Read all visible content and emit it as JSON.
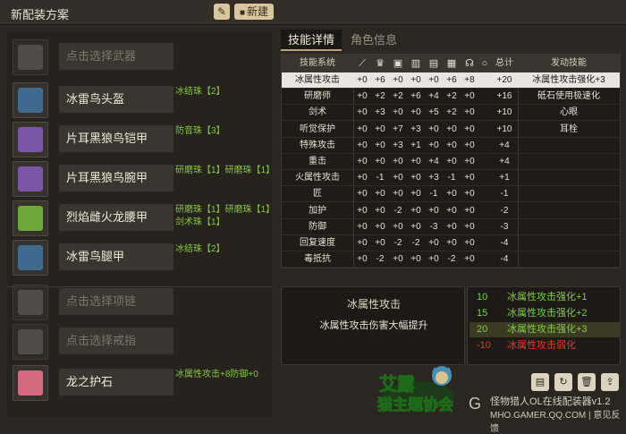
{
  "titlebar": {
    "title": "新配装方案",
    "new_label": "新建",
    "edit_icon": "pencil-icon"
  },
  "slots": [
    {
      "name": "点击选择武器",
      "deco": "",
      "empty": true,
      "icon": "weapon-icon",
      "color": "#6d6a63"
    },
    {
      "name": "冰雷鸟头盔",
      "deco": "冰结珠【2】",
      "empty": false,
      "icon": "helmet-icon",
      "color": "#3e6a8f"
    },
    {
      "name": "片耳黑狼鸟铠甲",
      "deco": "防音珠【3】",
      "empty": false,
      "icon": "chest-icon",
      "color": "#7b55a6"
    },
    {
      "name": "片耳黑狼鸟腕甲",
      "deco": "研磨珠【1】研磨珠【1】",
      "empty": false,
      "icon": "arm-icon",
      "color": "#7b55a6"
    },
    {
      "name": "烈焰雌火龙腰甲",
      "deco": "研磨珠【1】研磨珠【1】剑术珠【1】",
      "empty": false,
      "icon": "waist-icon",
      "color": "#6da63a"
    },
    {
      "name": "冰雷鸟腿甲",
      "deco": "冰结珠【2】",
      "empty": false,
      "icon": "legs-icon",
      "color": "#3e6a8f"
    },
    {
      "name": "点击选择项链",
      "deco": "",
      "empty": true,
      "icon": "necklace-icon",
      "color": "#6d6a63"
    },
    {
      "name": "点击选择戒指",
      "deco": "",
      "empty": true,
      "icon": "ring-icon",
      "color": "#6d6a63"
    },
    {
      "name": "龙之护石",
      "deco": "冰属性攻击+8防御+0",
      "empty": false,
      "icon": "charm-icon",
      "color": "#d46a7e"
    }
  ],
  "tabs": {
    "skills": "技能详情",
    "stats": "角色信息"
  },
  "table": {
    "headers": {
      "system": "技能系统",
      "total": "总计",
      "activated": "发动技能"
    },
    "rows": [
      {
        "name": "冰属性攻击",
        "vals": [
          "+0",
          "+6",
          "+0",
          "+0",
          "+0",
          "+6",
          "+8"
        ],
        "total": "+20",
        "act": "冰属性攻击强化+3",
        "selected": true
      },
      {
        "name": "研磨师",
        "vals": [
          "+0",
          "+2",
          "+2",
          "+6",
          "+4",
          "+2",
          "+0"
        ],
        "total": "+16",
        "act": "砥石使用极速化",
        "selected": false
      },
      {
        "name": "剑术",
        "vals": [
          "+0",
          "+3",
          "+0",
          "+0",
          "+5",
          "+2",
          "+0"
        ],
        "total": "+10",
        "act": "心眼",
        "selected": false
      },
      {
        "name": "听觉保护",
        "vals": [
          "+0",
          "+0",
          "+7",
          "+3",
          "+0",
          "+0",
          "+0"
        ],
        "total": "+10",
        "act": "耳栓",
        "selected": false
      },
      {
        "name": "特殊攻击",
        "vals": [
          "+0",
          "+0",
          "+3",
          "+1",
          "+0",
          "+0",
          "+0"
        ],
        "total": "+4",
        "act": "",
        "selected": false
      },
      {
        "name": "重击",
        "vals": [
          "+0",
          "+0",
          "+0",
          "+0",
          "+4",
          "+0",
          "+0"
        ],
        "total": "+4",
        "act": "",
        "selected": false
      },
      {
        "name": "火属性攻击",
        "vals": [
          "+0",
          "-1",
          "+0",
          "+0",
          "+3",
          "-1",
          "+0"
        ],
        "total": "+1",
        "act": "",
        "selected": false
      },
      {
        "name": "匠",
        "vals": [
          "+0",
          "+0",
          "+0",
          "+0",
          "-1",
          "+0",
          "+0"
        ],
        "total": "-1",
        "act": "",
        "selected": false
      },
      {
        "name": "加护",
        "vals": [
          "+0",
          "+0",
          "-2",
          "+0",
          "+0",
          "+0",
          "+0"
        ],
        "total": "-2",
        "act": "",
        "selected": false
      },
      {
        "name": "防御",
        "vals": [
          "+0",
          "+0",
          "+0",
          "+0",
          "-3",
          "+0",
          "+0"
        ],
        "total": "-3",
        "act": "",
        "selected": false
      },
      {
        "name": "回复速度",
        "vals": [
          "+0",
          "+0",
          "-2",
          "-2",
          "+0",
          "+0",
          "+0"
        ],
        "total": "-4",
        "act": "",
        "selected": false
      },
      {
        "name": "毒抵抗",
        "vals": [
          "+0",
          "-2",
          "+0",
          "+0",
          "+0",
          "-2",
          "+0"
        ],
        "total": "-4",
        "act": "",
        "selected": false
      }
    ]
  },
  "detail": {
    "title": "冰属性攻击",
    "desc": "冰属性攻击伤害大幅提升"
  },
  "levels": [
    {
      "pts": "10",
      "txt": "冰属性攻击强化+1",
      "neg": false,
      "hl": false
    },
    {
      "pts": "15",
      "txt": "冰属性攻击强化+2",
      "neg": false,
      "hl": false
    },
    {
      "pts": "20",
      "txt": "冰属性攻击强化+3",
      "neg": false,
      "hl": true
    },
    {
      "pts": "-10",
      "txt": "冰属性攻击弱化",
      "neg": true,
      "hl": false
    }
  ],
  "brand": {
    "line1": "怪物猎人OL在线配装器v1.2",
    "line2": "MHO.GAMER.QQ.COM | 意见反馈",
    "logo_text": "艾露猫主题协会"
  }
}
